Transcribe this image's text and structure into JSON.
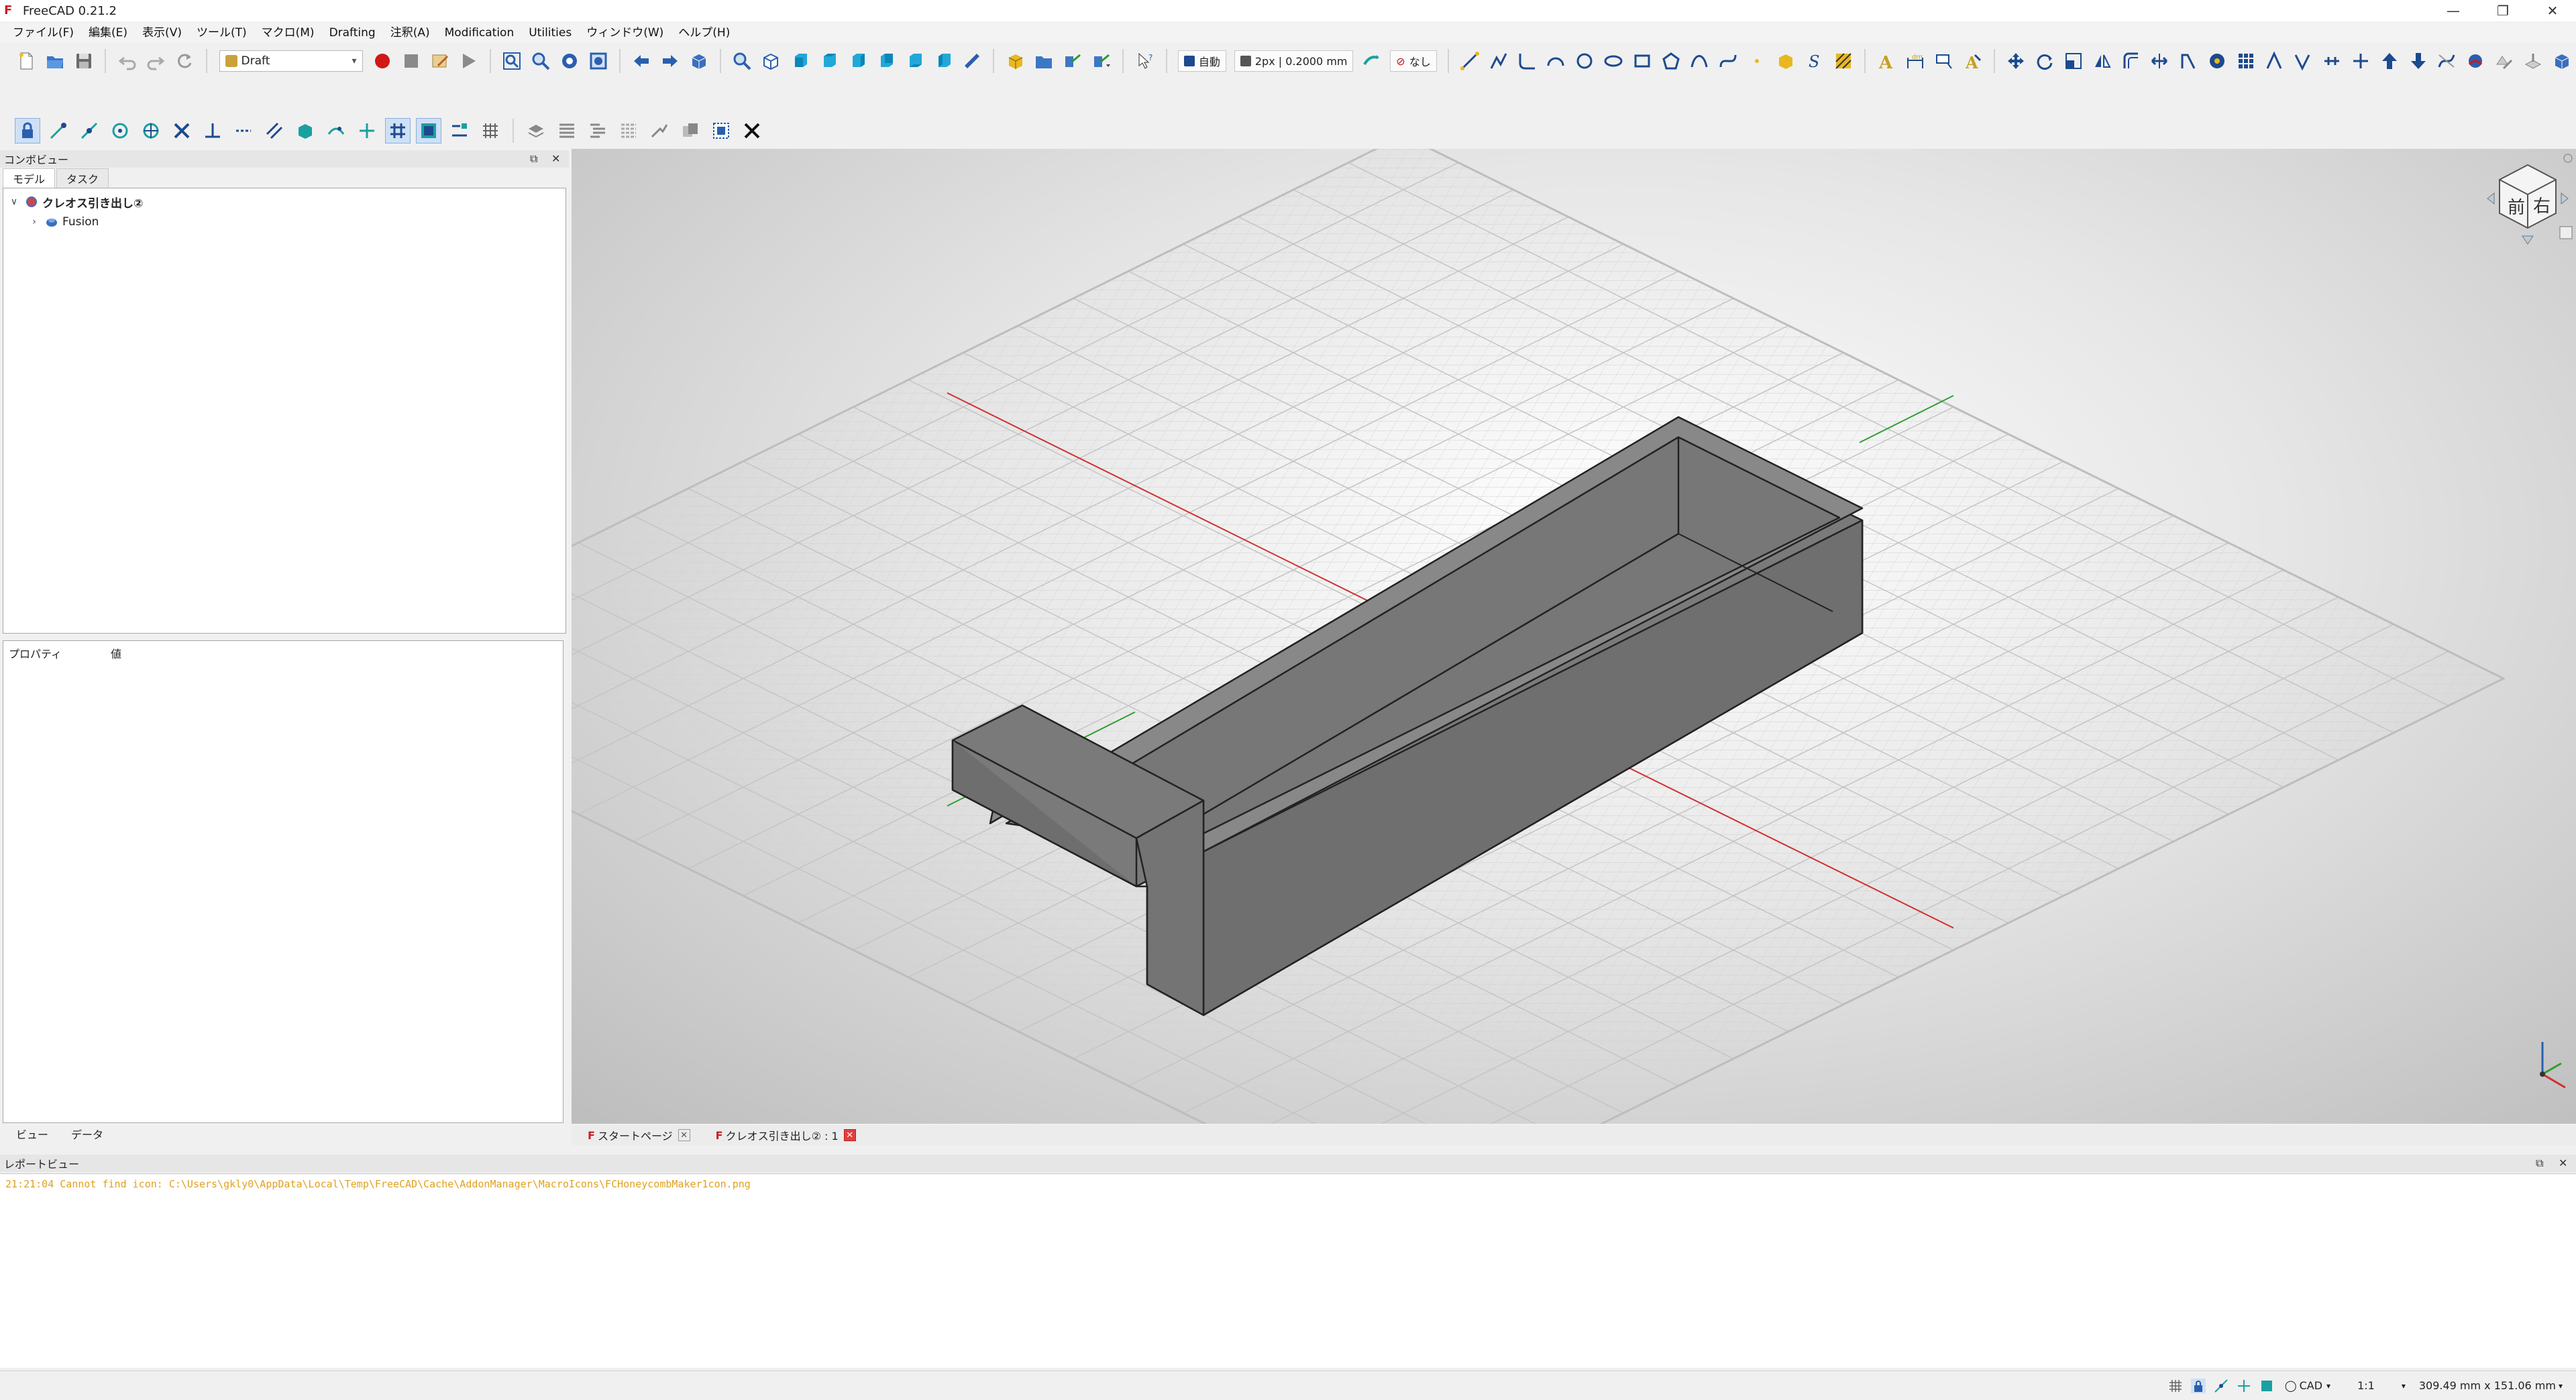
{
  "window": {
    "title": "FreeCAD 0.21.2",
    "app_icon": "freecad-logo-icon",
    "controls": [
      "minimize",
      "restore",
      "close"
    ]
  },
  "menu": [
    "ファイル(F)",
    "編集(E)",
    "表示(V)",
    "ツール(T)",
    "マクロ(M)",
    "Drafting",
    "注釈(A)",
    "Modification",
    "Utilities",
    "ウィンドウ(W)",
    "ヘルプ(H)"
  ],
  "toolbar": {
    "workbench": "Draft",
    "auto_label": "自動",
    "line_style": "2px | 0.2000 mm",
    "snap_none": "なし"
  },
  "combo_view": {
    "title": "コンボビュー",
    "tabs": [
      "モデル",
      "タスク"
    ],
    "tree": [
      {
        "label": "クレオス引き出し②",
        "expanded": true,
        "icon": "document-icon"
      },
      {
        "label": "Fusion",
        "expanded": false,
        "icon": "fusion-solid-icon"
      }
    ],
    "property_headers": [
      "プロパティ",
      "値"
    ],
    "bottom_tabs": [
      "ビュー",
      "データ"
    ]
  },
  "doc_tabs": [
    {
      "label": "スタートページ",
      "active": false
    },
    {
      "label": "クレオス引き出し② : 1",
      "active": true
    }
  ],
  "report_view": {
    "title": "レポートビュー",
    "log": "21:21:04  Cannot find icon: C:\\Users\\gkly0\\AppData\\Local\\Temp\\FreeCAD\\Cache\\AddonManager\\MacroIcons\\FCHoneycombMaker1con.png"
  },
  "statusbar": {
    "nav_style": "CAD",
    "scale": "1:1",
    "dimensions": "309.49 mm x 151.06 mm"
  },
  "nav_cube": {
    "faces": [
      "前",
      "右"
    ]
  },
  "colors": {
    "accent": "#2a5fae",
    "record": "#d01818",
    "axis_x": "#d03030",
    "axis_y": "#30a030",
    "solid": "#7a7a7a"
  }
}
